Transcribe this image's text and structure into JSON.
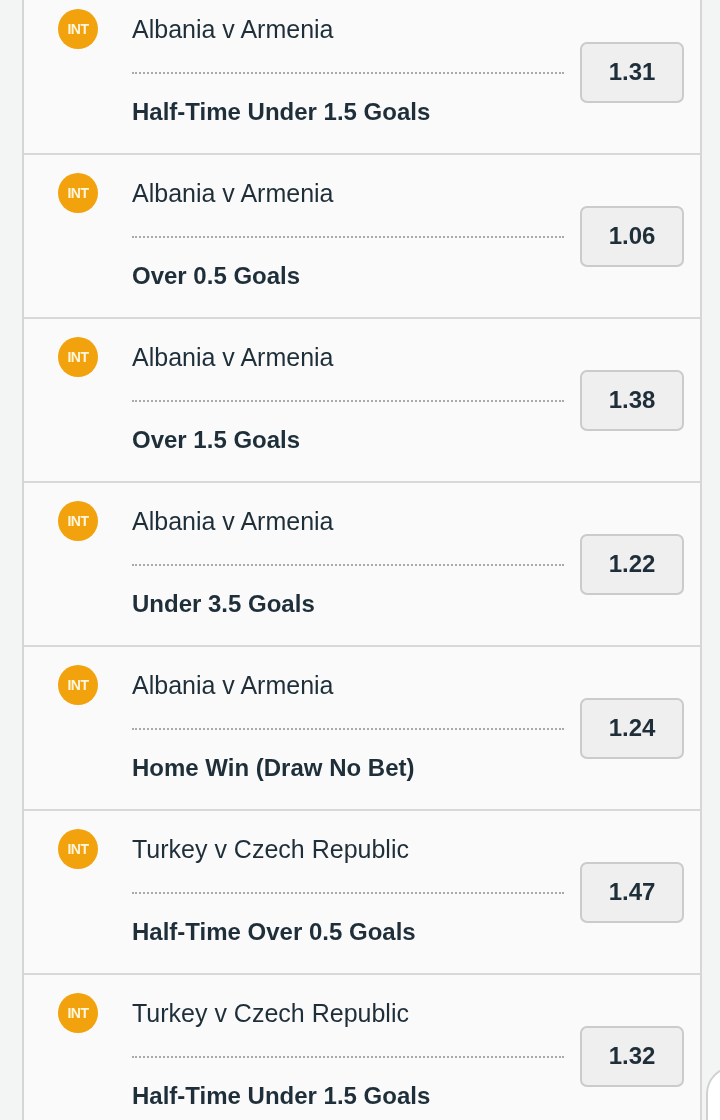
{
  "selections": [
    {
      "badge": "INT",
      "match": "Albania v Armenia",
      "market": "Half-Time Under 1.5 Goals",
      "odds": "1.31"
    },
    {
      "badge": "INT",
      "match": "Albania v Armenia",
      "market": "Over 0.5 Goals",
      "odds": "1.06"
    },
    {
      "badge": "INT",
      "match": "Albania v Armenia",
      "market": "Over 1.5 Goals",
      "odds": "1.38"
    },
    {
      "badge": "INT",
      "match": "Albania v Armenia",
      "market": "Under 3.5 Goals",
      "odds": "1.22"
    },
    {
      "badge": "INT",
      "match": "Albania v Armenia",
      "market": "Home Win (Draw No Bet)",
      "odds": "1.24"
    },
    {
      "badge": "INT",
      "match": "Turkey v Czech Republic",
      "market": "Half-Time Over 0.5 Goals",
      "odds": "1.47"
    },
    {
      "badge": "INT",
      "match": "Turkey v Czech Republic",
      "market": "Half-Time Under 1.5 Goals",
      "odds": "1.32"
    }
  ]
}
